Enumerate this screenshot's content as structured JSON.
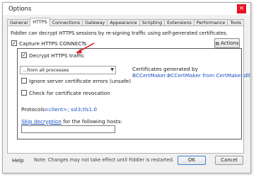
{
  "window": {
    "title": "Options",
    "close_glyph": "×"
  },
  "tabs": [
    {
      "label": "General"
    },
    {
      "label": "HTTPS"
    },
    {
      "label": "Connections"
    },
    {
      "label": "Gateway"
    },
    {
      "label": "Appearance"
    },
    {
      "label": "Scripting"
    },
    {
      "label": "Extensions"
    },
    {
      "label": "Performance"
    },
    {
      "label": "Tools"
    }
  ],
  "https": {
    "description": "Fiddler can decrypt HTTPS sessions by re-signing traffic using self-generated certificates.",
    "capture_label": "Capture HTTPS CONNECTs",
    "capture_checked": true,
    "decrypt_label": "Decrypt HTTPS traffic",
    "decrypt_checked": true,
    "process_filter": "...from all processes",
    "ignore_errors_label": "Ignore server certificate errors (unsafe)",
    "revocation_label": "Check for certificate revocation",
    "cert_info_line1": "Certificates generated by",
    "cert_info_line2": "BCCertMaker.BCCertMaker from CertMaker.dll",
    "actions_label": "Actions",
    "protocols_label": "Protocols:",
    "protocols_value": "<client>; ssl3;tls1.0",
    "skip_link": "Skip decryption",
    "skip_suffix": " for the following hosts:"
  },
  "footer": {
    "help": "Help",
    "note": "Note: Changes may not take effect until Fiddler is restarted.",
    "ok": "OK",
    "cancel": "Cancel"
  },
  "colors": {
    "annotation_arrow": "#e0202a",
    "link": "#1a4fc4",
    "close": "#e81123"
  }
}
